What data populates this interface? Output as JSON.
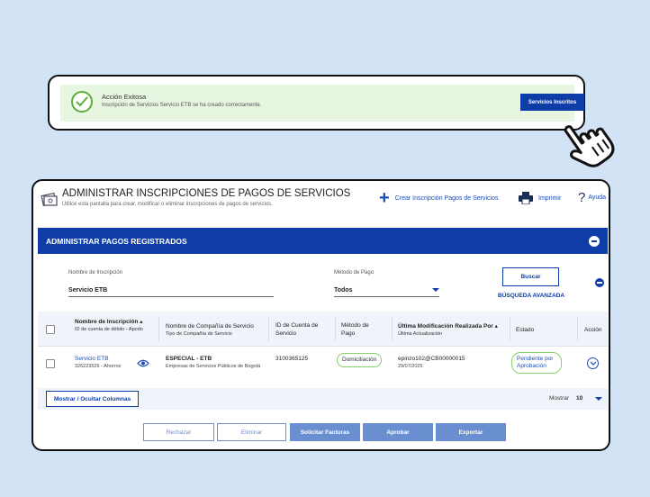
{
  "banner": {
    "title": "Acción Exitosa",
    "message": "Inscripción de Servicios Servicio ETB se ha creado correctamente.",
    "button_label": "Servicios Inscritos",
    "success_color": "#5cae3c"
  },
  "header": {
    "title": "ADMINISTRAR INSCRIPCIONES DE PAGOS DE SERVICIOS",
    "subtitle": "Utilice esta pantalla para crear, modificar o eliminar inscripciones de pagos de servicios.",
    "create_label": "Crear Inscripción Pagos de Servicios",
    "print_label": "Imprimir",
    "help_label": "Ayuda"
  },
  "section": {
    "title": "ADMINISTRAR PAGOS REGISTRADOS"
  },
  "filters": {
    "name_label": "Nombre de Inscripción",
    "name_value": "Servicio ETB",
    "method_label": "Método de Pago",
    "method_value": "Todos",
    "search_button": "Buscar",
    "advanced_search": "BÚSQUEDA AVANZADA"
  },
  "table": {
    "headers": {
      "name": "Nombre de Inscripción",
      "name_sub": "ID de cuenta de débito - Apodo",
      "company": "Nombre de Compañía de Servicio",
      "company_sub": "Tipo de Compañía de Servicio",
      "account": "ID de Cuenta de Servicio",
      "method": "Método de Pago",
      "modified": "Última Modificación Realizada Por",
      "modified_sub": "Última Actualización",
      "status": "Estado",
      "action": "Acción"
    },
    "rows": [
      {
        "name": "Servicio ETB",
        "debit_account": "326223526 - Ahorros",
        "company": "ESPECIAL - ETB",
        "company_type": "Empresas de Servicios Públicos de Bogotá",
        "account_id": "3100365125",
        "method": "Domiciliación",
        "modified_by": "epinzo102@CB00000015",
        "modified_date": "29/07/2025",
        "status": "Pendiente por Aprobación"
      }
    ]
  },
  "footer": {
    "columns_button": "Mostrar / Ocultar Columnas",
    "show_label": "Mostrar",
    "show_value": "10"
  },
  "actions": {
    "reject": "Rechazar",
    "delete": "Eliminar",
    "request_invoices": "Solicitar Facturas",
    "approve": "Aprobar",
    "export": "Exportar"
  },
  "colors": {
    "brand_blue": "#0f3da8",
    "page_bg": "#d3e3f6",
    "pill_green": "#8ad06b"
  }
}
